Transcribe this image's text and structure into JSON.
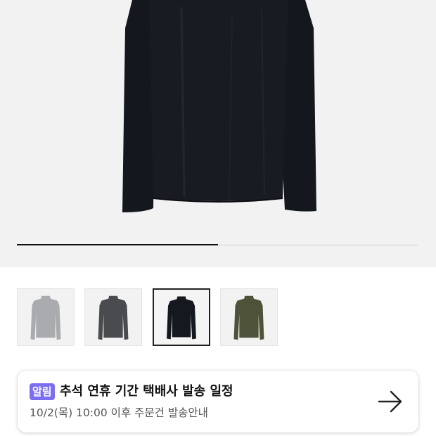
{
  "product": {
    "image_alt_icon": "black-turtleneck-icon",
    "gallery_progress": 0.5
  },
  "colors": {
    "hero_bg": "#f2f2f2",
    "badge_bg": "#7b6ef0",
    "garment_black": "#14171e",
    "accent_dark": "#111111"
  },
  "thumbnails": [
    {
      "icon": "gray-turtleneck-icon",
      "color": "#a9abaf",
      "selected": false
    },
    {
      "icon": "charcoal-turtleneck-icon",
      "color": "#4a4b4f",
      "selected": false
    },
    {
      "icon": "black-turtleneck-icon",
      "color": "#161820",
      "selected": true
    },
    {
      "icon": "olive-turtleneck-icon",
      "color": "#4e5238",
      "selected": false
    }
  ],
  "notice": {
    "badge": "알림",
    "title": "추석 연휴 기간 택배사 발송 일정",
    "subtitle": "10/2(목) 10:00 이후 주문건 발송안내",
    "arrow_icon": "arrow-right-icon"
  }
}
